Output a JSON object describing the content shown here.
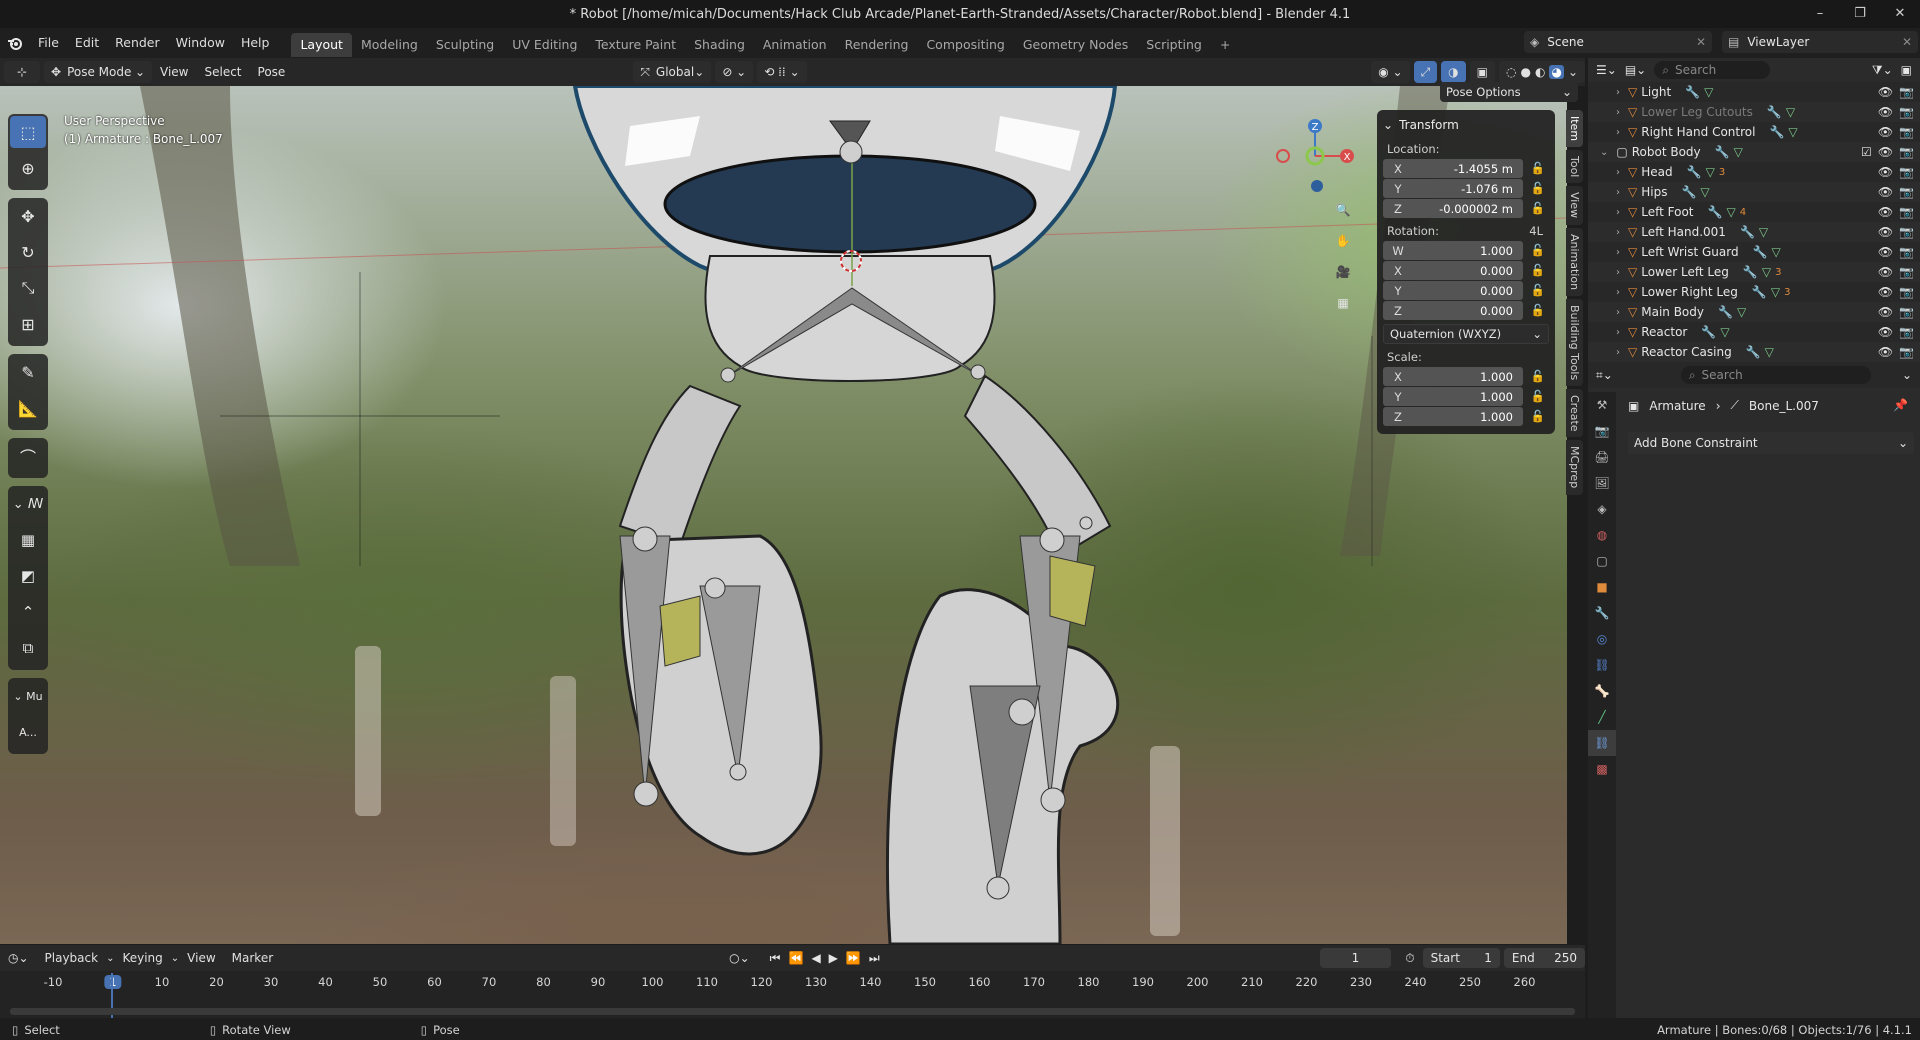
{
  "window": {
    "title": "* Robot [/home/micah/Documents/Hack Club Arcade/Planet-Earth-Stranded/Assets/Character/Robot.blend] - Blender 4.1"
  },
  "topbar": {
    "menus": [
      "File",
      "Edit",
      "Render",
      "Window",
      "Help"
    ],
    "workspaces": [
      "Layout",
      "Modeling",
      "Sculpting",
      "UV Editing",
      "Texture Paint",
      "Shading",
      "Animation",
      "Rendering",
      "Compositing",
      "Geometry Nodes",
      "Scripting"
    ],
    "active_workspace": "Layout",
    "scene": "Scene",
    "view_layer": "ViewLayer"
  },
  "viewport_header": {
    "mode": "Pose Mode",
    "menus": [
      "View",
      "Select",
      "Pose"
    ],
    "orientation": "Global",
    "pose_options": "Pose Options"
  },
  "viewport": {
    "perspective_label": "User Perspective",
    "object_label": "(1) Armature : Bone_L.007",
    "gizmo": {
      "z": "Z",
      "y": "Y",
      "x": "X"
    }
  },
  "npanel": {
    "section": "Transform",
    "location_label": "Location:",
    "location": [
      {
        "axis": "X",
        "value": "-1.4055 m"
      },
      {
        "axis": "Y",
        "value": "-1.076 m"
      },
      {
        "axis": "Z",
        "value": "-0.000002 m"
      }
    ],
    "rotation_label": "Rotation:",
    "rotation_mode_short": "4L",
    "rotation": [
      {
        "axis": "W",
        "value": "1.000"
      },
      {
        "axis": "X",
        "value": "0.000"
      },
      {
        "axis": "Y",
        "value": "0.000"
      },
      {
        "axis": "Z",
        "value": "0.000"
      }
    ],
    "rotation_mode": "Quaternion (WXYZ)",
    "scale_label": "Scale:",
    "scale": [
      {
        "axis": "X",
        "value": "1.000"
      },
      {
        "axis": "Y",
        "value": "1.000"
      },
      {
        "axis": "Z",
        "value": "1.000"
      }
    ],
    "tabs": [
      "Item",
      "Tool",
      "View",
      "Animation",
      "Building Tools",
      "Create",
      "MCprep"
    ]
  },
  "outliner": {
    "search_placeholder": "Search",
    "rows": [
      {
        "name": "Light",
        "indent": 1,
        "dim": false
      },
      {
        "name": "Lower Leg Cutouts",
        "indent": 1,
        "dim": true
      },
      {
        "name": "Right Hand Control",
        "indent": 1,
        "dim": false
      },
      {
        "name": "Robot Body",
        "indent": 0,
        "dim": false
      },
      {
        "name": "Head",
        "indent": 1,
        "dim": false,
        "badge": "3"
      },
      {
        "name": "Hips",
        "indent": 1,
        "dim": false
      },
      {
        "name": "Left Foot",
        "indent": 1,
        "dim": false,
        "badge": "4"
      },
      {
        "name": "Left Hand.001",
        "indent": 1,
        "dim": false
      },
      {
        "name": "Left Wrist Guard",
        "indent": 1,
        "dim": false
      },
      {
        "name": "Lower Left Leg",
        "indent": 1,
        "dim": false,
        "badge": "3"
      },
      {
        "name": "Lower Right Leg",
        "indent": 1,
        "dim": false,
        "badge": "3"
      },
      {
        "name": "Main Body",
        "indent": 1,
        "dim": false
      },
      {
        "name": "Reactor",
        "indent": 1,
        "dim": false
      },
      {
        "name": "Reactor Casing",
        "indent": 1,
        "dim": false
      }
    ]
  },
  "properties": {
    "search_placeholder": "Search",
    "breadcrumb_object": "Armature",
    "breadcrumb_bone": "Bone_L.007",
    "add_constraint": "Add Bone Constraint"
  },
  "timeline": {
    "menus": [
      "Playback",
      "Keying",
      "View",
      "Marker"
    ],
    "current_frame": "1",
    "start_label": "Start",
    "start": "1",
    "end_label": "End",
    "end": "250",
    "ticks": [
      "-10",
      "1",
      "10",
      "20",
      "30",
      "40",
      "50",
      "60",
      "70",
      "80",
      "90",
      "100",
      "110",
      "120",
      "130",
      "140",
      "150",
      "160",
      "170",
      "180",
      "190",
      "200",
      "210",
      "220",
      "230",
      "240",
      "250",
      "260"
    ]
  },
  "statusbar": {
    "select": "Select",
    "rotate": "Rotate View",
    "pose": "Pose",
    "stats": "Armature | Bones:0/68 | Objects:1/76 | 4.1.1"
  },
  "colors": {
    "accent": "#4772b3",
    "mesh_orange": "#e08a3c",
    "mesh_green": "#7cc98a"
  }
}
